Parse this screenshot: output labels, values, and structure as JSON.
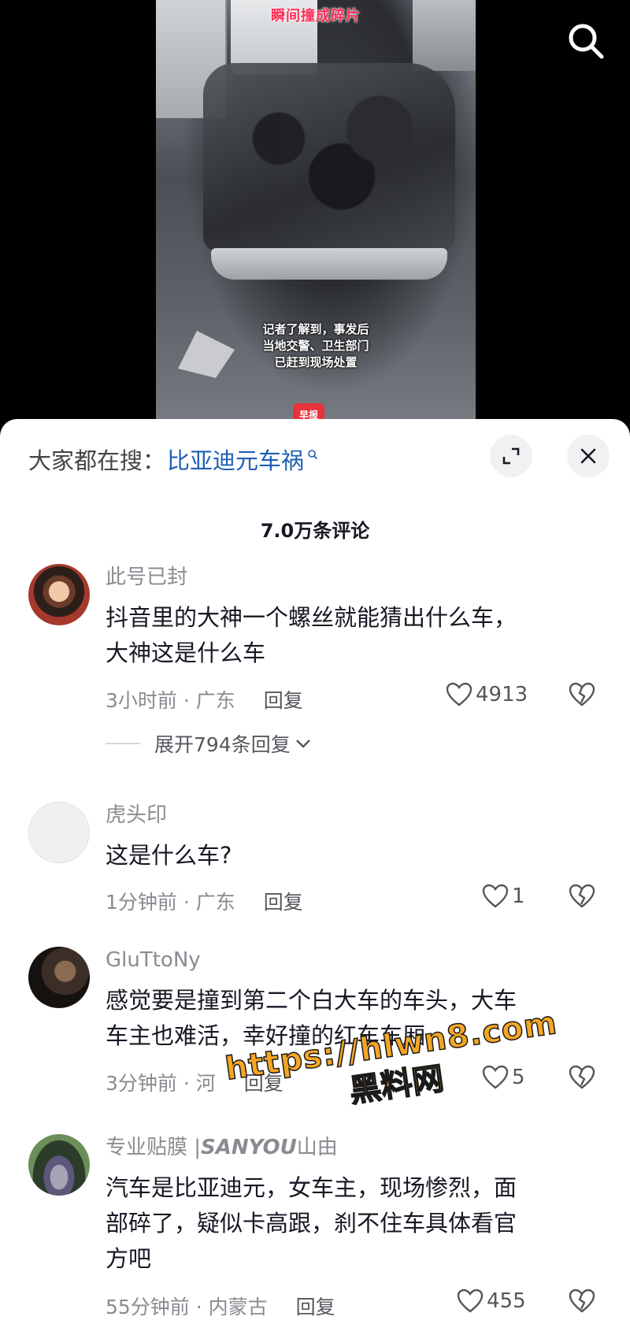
{
  "video": {
    "top_caption": "瞬间撞成碎片",
    "subtitle_lines": [
      "记者了解到，事发后",
      "当地交警、卫生部门",
      "已赶到现场处置"
    ],
    "badge": "早报",
    "search_icon": "search-icon"
  },
  "sheet": {
    "hot_search_prefix": "大家都在搜：",
    "hot_search_term": "比亚迪元车祸",
    "expand_icon": "expand-icon",
    "close_icon": "close-icon",
    "comment_count": "7.0万条评论"
  },
  "comments": [
    {
      "username": "此号已封",
      "lines": [
        "抖音里的大神一个螺丝就能猜出什么车，",
        "大神这是什么车"
      ],
      "time_location": "3小时前 · 广东",
      "reply_label": "回复",
      "likes": "4913",
      "expand_replies": "展开794条回复"
    },
    {
      "username": "虎头印",
      "lines": [
        "这是什么车?"
      ],
      "time_location": "1分钟前 · 广东",
      "reply_label": "回复",
      "likes": "1"
    },
    {
      "username": "GluTtoNy",
      "lines": [
        "感觉要是撞到第二个白大车的车头，大车",
        "车主也难活，幸好撞的红车车厢"
      ],
      "time_location": "3分钟前 · 河",
      "reply_label": "回复",
      "likes": "5"
    },
    {
      "username_prefix": "专业贴膜 |",
      "username_brand": "SANYOU",
      "username_suffix": "山由",
      "lines": [
        "汽车是比亚迪元，女车主，现场惨烈，面",
        "部碎了，疑似卡高跟，刹不住车具体看官",
        "方吧"
      ],
      "time_location": "55分钟前 · 内蒙古",
      "reply_label": "回复",
      "likes": "455"
    }
  ],
  "watermark": {
    "url": "https://hlwn8.com",
    "name": "黑料网"
  },
  "colors": {
    "link_blue": "#1f5fb5",
    "watermark_orange": "#f5a623",
    "badge_red": "#e8323c"
  }
}
